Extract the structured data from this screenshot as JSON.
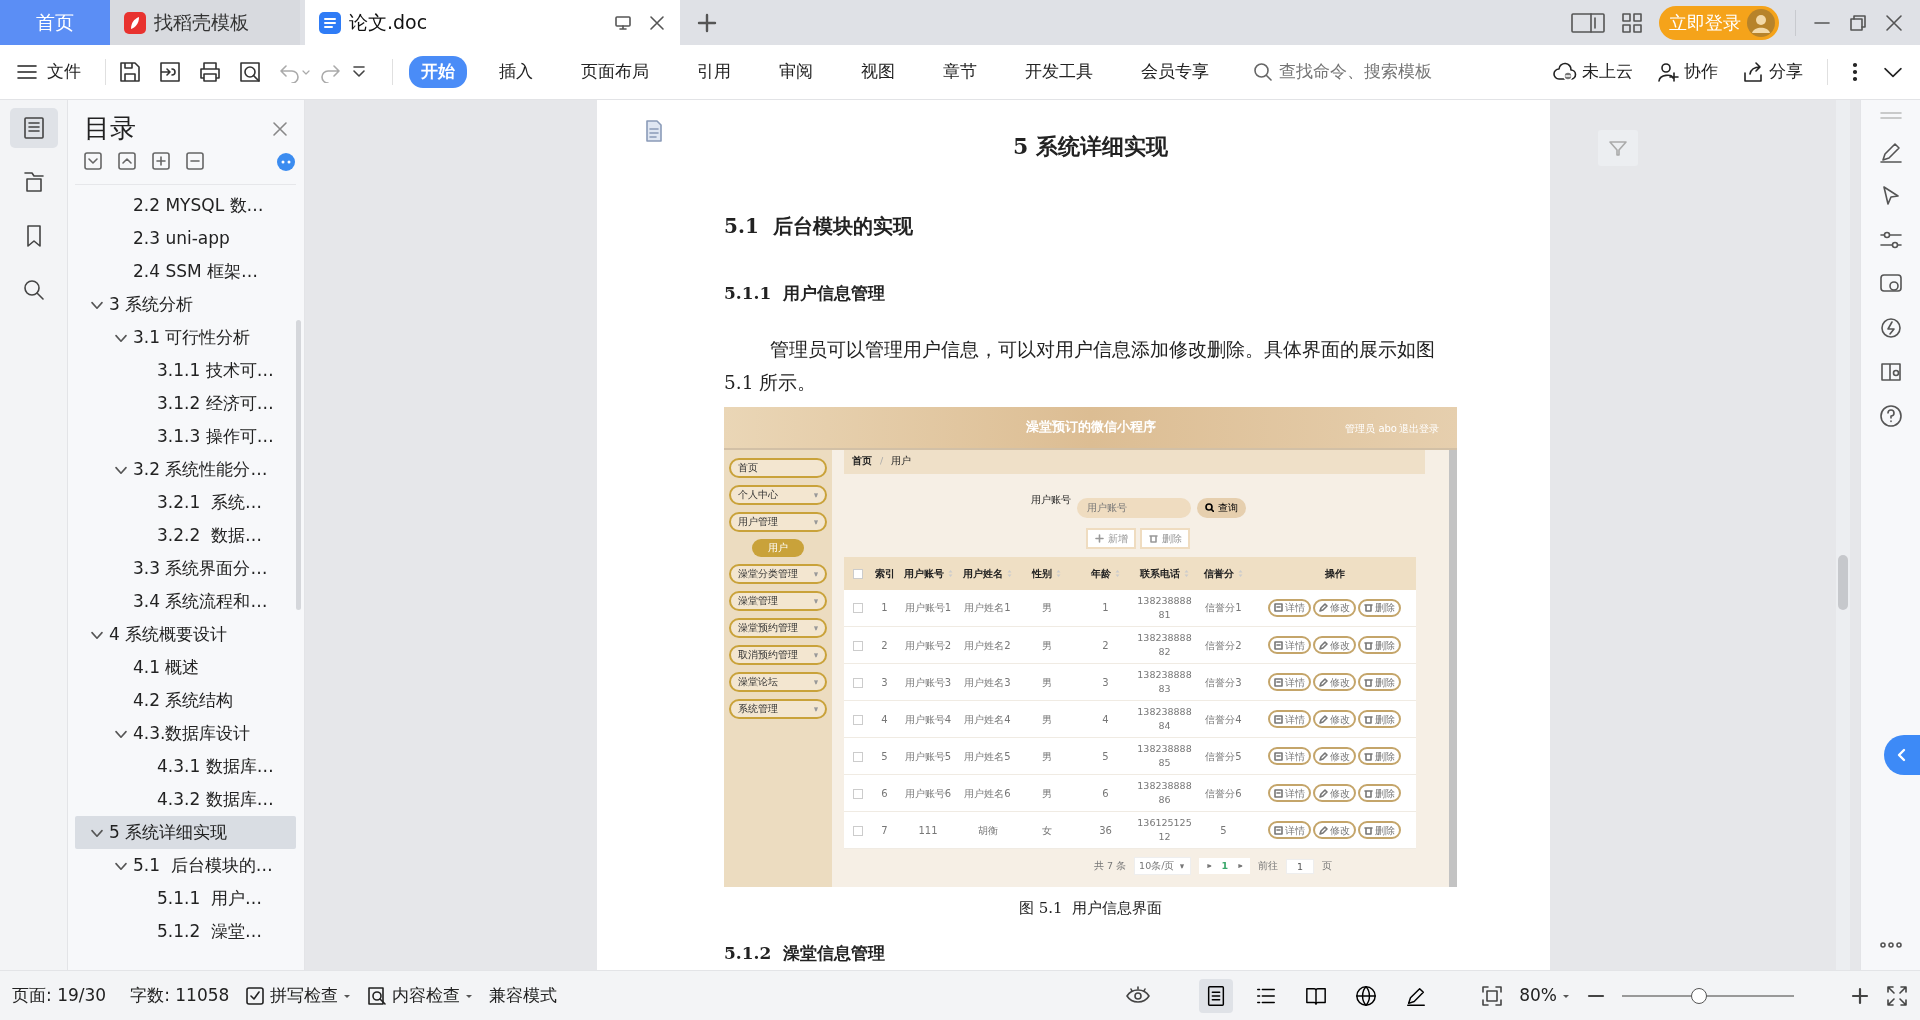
{
  "tabs": [
    {
      "label": "首页",
      "kind": "home",
      "selected": false
    },
    {
      "label": "找稻壳模板",
      "kind": "template",
      "selected": false
    },
    {
      "label": "论文.doc",
      "kind": "doc",
      "selected": true
    }
  ],
  "login_button": "立即登录",
  "menu": {
    "file": "文件",
    "ribbon": [
      {
        "label": "开始",
        "selected": true
      },
      {
        "label": "插入",
        "selected": false
      },
      {
        "label": "页面布局",
        "selected": false
      },
      {
        "label": "引用",
        "selected": false
      },
      {
        "label": "审阅",
        "selected": false
      },
      {
        "label": "视图",
        "selected": false
      },
      {
        "label": "章节",
        "selected": false
      },
      {
        "label": "开发工具",
        "selected": false
      },
      {
        "label": "会员专享",
        "selected": false
      }
    ]
  },
  "search": {
    "placeholder": "查找命令、搜索模板"
  },
  "actions": [
    {
      "label": "未上云",
      "kind": "cloud"
    },
    {
      "label": "协作",
      "kind": "collab"
    },
    {
      "label": "分享",
      "kind": "share"
    }
  ],
  "side_panels": [
    {
      "kind": "toc",
      "selected": true
    },
    {
      "kind": "nav",
      "selected": false
    },
    {
      "kind": "bookmark",
      "selected": false
    },
    {
      "kind": "search",
      "selected": false
    }
  ],
  "toc": {
    "title": "目录",
    "items": [
      {
        "children": [
          {
            "label": "2.2 MYSQL 数…",
            "selected": false
          },
          {
            "label": "2.3 uni-app",
            "selected": false
          },
          {
            "label": "2.4 SSM 框架…",
            "selected": false
          }
        ]
      },
      {
        "label": "3 系统分析",
        "selected": false,
        "expanded": true,
        "children": [
          {
            "label": "3.1 可行性分析",
            "selected": false,
            "expanded": true,
            "children": [
              {
                "label": "3.1.1 技术可…",
                "selected": false
              },
              {
                "label": "3.1.2 经济可…",
                "selected": false
              },
              {
                "label": "3.1.3 操作可…",
                "selected": false
              }
            ]
          },
          {
            "label": "3.2 系统性能分…",
            "selected": false,
            "expanded": true,
            "children": [
              {
                "label": "3.2.1  系统…",
                "selected": false
              },
              {
                "label": "3.2.2  数据…",
                "selected": false
              }
            ]
          },
          {
            "label": "3.3 系统界面分…",
            "selected": false
          },
          {
            "label": "3.4 系统流程和…",
            "selected": false
          }
        ]
      },
      {
        "label": "4 系统概要设计",
        "selected": false,
        "expanded": true,
        "children": [
          {
            "label": "4.1 概述",
            "selected": false
          },
          {
            "label": "4.2 系统结构",
            "selected": false
          },
          {
            "label": "4.3.数据库设计",
            "selected": false,
            "expanded": true,
            "children": [
              {
                "label": "4.3.1 数据库…",
                "selected": false
              },
              {
                "label": "4.3.2 数据库…",
                "selected": false
              }
            ]
          }
        ]
      },
      {
        "label": "5 系统详细实现",
        "selected": true,
        "expanded": true,
        "children": [
          {
            "label": "5.1  后台模块的…",
            "selected": false,
            "expanded": true,
            "children": [
              {
                "label": "5.1.1  用户…",
                "selected": false
              },
              {
                "label": "5.1.2  澡堂…",
                "selected": false
              }
            ]
          }
        ]
      }
    ]
  },
  "document": {
    "heading": "5 系统详细实现",
    "section": "5.1  后台模块的实现",
    "subsection": "5.1.1  用户信息管理",
    "paragraph": "管理员可以管理用户信息，可以对用户信息添加修改删除。具体界面的展示如图 5.1 所示。",
    "figure": {
      "title": "澡堂预订的微信小程序",
      "user": "管理员 abo",
      "logout": "退出登录",
      "menu": [
        {
          "label": "首页",
          "kind": "link"
        },
        {
          "label": "个人中心",
          "kind": "group"
        },
        {
          "label": "用户管理",
          "kind": "group",
          "children": [
            {
              "label": "用户",
              "selected": true
            }
          ]
        },
        {
          "label": "澡堂分类管理",
          "kind": "group"
        },
        {
          "label": "澡堂管理",
          "kind": "group"
        },
        {
          "label": "澡堂预约管理",
          "kind": "group"
        },
        {
          "label": "取消预约管理",
          "kind": "group"
        },
        {
          "label": "澡堂论坛",
          "kind": "group"
        },
        {
          "label": "系统管理",
          "kind": "group"
        }
      ],
      "breadcrumb": [
        "首页",
        "用户"
      ],
      "breadcrumb_separator": "/",
      "search": {
        "label": "用户账号",
        "placeholder": "用户账号",
        "button": "查询"
      },
      "buttons": [
        {
          "label": "新增",
          "kind": "add"
        },
        {
          "label": "删除",
          "kind": "delete"
        }
      ],
      "select_all_checked": false,
      "columns": [
        {
          "label": "索引",
          "sortable": false
        },
        {
          "label": "用户账号",
          "sortable": true
        },
        {
          "label": "用户姓名",
          "sortable": true
        },
        {
          "label": "性别",
          "sortable": true
        },
        {
          "label": "年龄",
          "sortable": true
        },
        {
          "label": "联系电话",
          "sortable": true
        },
        {
          "label": "信誉分",
          "sortable": true
        },
        {
          "label": "操作",
          "sortable": false
        }
      ],
      "rows": [
        {
          "checked": false,
          "cells": [
            "1",
            "用户账号1",
            "用户姓名1",
            "男",
            "1",
            "13823888881",
            "信誉分1"
          ],
          "actions": [
            "详情",
            "修改",
            "删除"
          ]
        },
        {
          "checked": false,
          "cells": [
            "2",
            "用户账号2",
            "用户姓名2",
            "男",
            "2",
            "13823888882",
            "信誉分2"
          ],
          "actions": [
            "详情",
            "修改",
            "删除"
          ]
        },
        {
          "checked": false,
          "cells": [
            "3",
            "用户账号3",
            "用户姓名3",
            "男",
            "3",
            "13823888883",
            "信誉分3"
          ],
          "actions": [
            "详情",
            "修改",
            "删除"
          ]
        },
        {
          "checked": false,
          "cells": [
            "4",
            "用户账号4",
            "用户姓名4",
            "男",
            "4",
            "13823888884",
            "信誉分4"
          ],
          "actions": [
            "详情",
            "修改",
            "删除"
          ]
        },
        {
          "checked": false,
          "cells": [
            "5",
            "用户账号5",
            "用户姓名5",
            "男",
            "5",
            "13823888885",
            "信誉分5"
          ],
          "actions": [
            "详情",
            "修改",
            "删除"
          ]
        },
        {
          "checked": false,
          "cells": [
            "6",
            "用户账号6",
            "用户姓名6",
            "男",
            "6",
            "13823888886",
            "信誉分6"
          ],
          "actions": [
            "详情",
            "修改",
            "删除"
          ]
        },
        {
          "checked": false,
          "cells": [
            "7",
            "111",
            "胡衡",
            "女",
            "36",
            "13612512512",
            "5"
          ],
          "actions": [
            "详情",
            "修改",
            "删除"
          ]
        }
      ],
      "pagination": {
        "total": "共 7 条",
        "page_size": "10条/页",
        "page": "1",
        "goto_label": "前往",
        "goto_value": "1",
        "goto_suffix": "页"
      }
    },
    "caption": "图 5.1  用户信息界面",
    "next_subsection": "5.1.2  澡堂信息管理"
  },
  "status_bar": {
    "page": "页面: 19/30",
    "words": "字数: 11058",
    "tools": [
      {
        "label": "拼写检查",
        "kind": "spell"
      },
      {
        "label": "内容检查",
        "kind": "content"
      },
      {
        "label": "兼容模式",
        "kind": "plain"
      }
    ],
    "view_modes": [
      {
        "kind": "page",
        "selected": true
      },
      {
        "kind": "outline",
        "selected": false
      },
      {
        "kind": "read",
        "selected": false
      },
      {
        "kind": "web",
        "selected": false
      },
      {
        "kind": "write",
        "selected": false
      }
    ],
    "zoom": "80%",
    "zoom_slider": {
      "level": 0.45
    }
  }
}
